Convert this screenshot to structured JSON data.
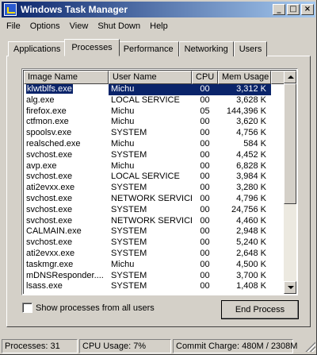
{
  "window": {
    "title": "Windows Task Manager"
  },
  "titlebar": {
    "minimize": "_",
    "maximize": "□",
    "close": "×"
  },
  "menu": [
    "File",
    "Options",
    "View",
    "Shut Down",
    "Help"
  ],
  "tabs": [
    "Applications",
    "Processes",
    "Performance",
    "Networking",
    "Users"
  ],
  "active_tab": "Processes",
  "columns": [
    "Image Name",
    "User Name",
    "CPU",
    "Mem Usage"
  ],
  "processes": [
    {
      "image": "klwtblfs.exe",
      "user": "Michu",
      "cpu": "00",
      "mem": "3,312 K",
      "selected": true
    },
    {
      "image": "alg.exe",
      "user": "LOCAL SERVICE",
      "cpu": "00",
      "mem": "3,628 K"
    },
    {
      "image": "firefox.exe",
      "user": "Michu",
      "cpu": "05",
      "mem": "144,396 K"
    },
    {
      "image": "ctfmon.exe",
      "user": "Michu",
      "cpu": "00",
      "mem": "3,620 K"
    },
    {
      "image": "spoolsv.exe",
      "user": "SYSTEM",
      "cpu": "00",
      "mem": "4,756 K"
    },
    {
      "image": "realsched.exe",
      "user": "Michu",
      "cpu": "00",
      "mem": "584 K"
    },
    {
      "image": "svchost.exe",
      "user": "SYSTEM",
      "cpu": "00",
      "mem": "4,452 K"
    },
    {
      "image": "avp.exe",
      "user": "Michu",
      "cpu": "00",
      "mem": "6,828 K"
    },
    {
      "image": "svchost.exe",
      "user": "LOCAL SERVICE",
      "cpu": "00",
      "mem": "3,984 K"
    },
    {
      "image": "ati2evxx.exe",
      "user": "SYSTEM",
      "cpu": "00",
      "mem": "3,280 K"
    },
    {
      "image": "svchost.exe",
      "user": "NETWORK SERVICE",
      "cpu": "00",
      "mem": "4,796 K"
    },
    {
      "image": "svchost.exe",
      "user": "SYSTEM",
      "cpu": "00",
      "mem": "24,756 K"
    },
    {
      "image": "svchost.exe",
      "user": "NETWORK SERVICE",
      "cpu": "00",
      "mem": "4,460 K"
    },
    {
      "image": "CALMAIN.exe",
      "user": "SYSTEM",
      "cpu": "00",
      "mem": "2,948 K"
    },
    {
      "image": "svchost.exe",
      "user": "SYSTEM",
      "cpu": "00",
      "mem": "5,240 K"
    },
    {
      "image": "ati2evxx.exe",
      "user": "SYSTEM",
      "cpu": "00",
      "mem": "2,648 K"
    },
    {
      "image": "taskmgr.exe",
      "user": "Michu",
      "cpu": "00",
      "mem": "4,500 K"
    },
    {
      "image": "mDNSResponder....",
      "user": "SYSTEM",
      "cpu": "00",
      "mem": "3,700 K"
    },
    {
      "image": "lsass.exe",
      "user": "SYSTEM",
      "cpu": "00",
      "mem": "1,408 K"
    }
  ],
  "show_all": {
    "label": "Show processes from all users",
    "checked": false
  },
  "end_process_label": "End Process",
  "status": {
    "processes": "Processes: 31",
    "cpu": "CPU Usage: 7%",
    "commit": "Commit Charge: 480M / 2308M"
  },
  "colors": {
    "title_start": "#0a246a",
    "title_end": "#a6caf0",
    "selection": "#0a246a",
    "face": "#d4d0c8"
  }
}
